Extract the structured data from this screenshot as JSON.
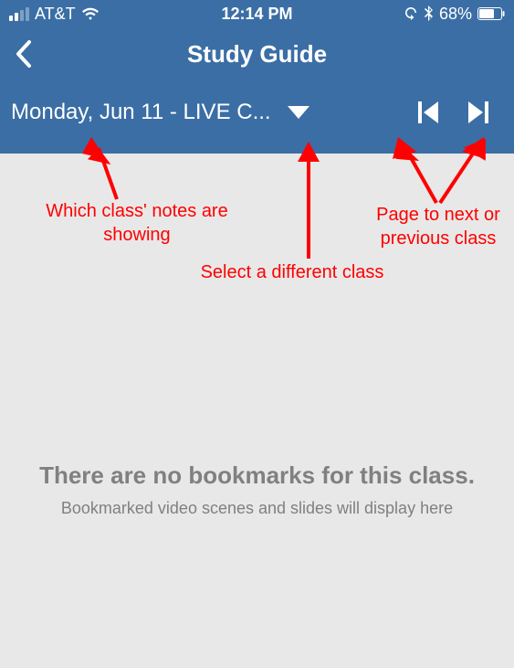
{
  "status": {
    "carrier": "AT&T",
    "time": "12:14 PM",
    "battery_pct": "68%"
  },
  "nav": {
    "title": "Study Guide"
  },
  "class_selector": {
    "label": "Monday, Jun 11 - LIVE C..."
  },
  "empty": {
    "title": "There are no bookmarks for this class.",
    "subtitle": "Bookmarked video scenes and slides will display here"
  },
  "annotations": {
    "which_class": "Which class' notes are\nshowing",
    "select_class": "Select a different class",
    "page_class": "Page to next or\nprevious class"
  }
}
